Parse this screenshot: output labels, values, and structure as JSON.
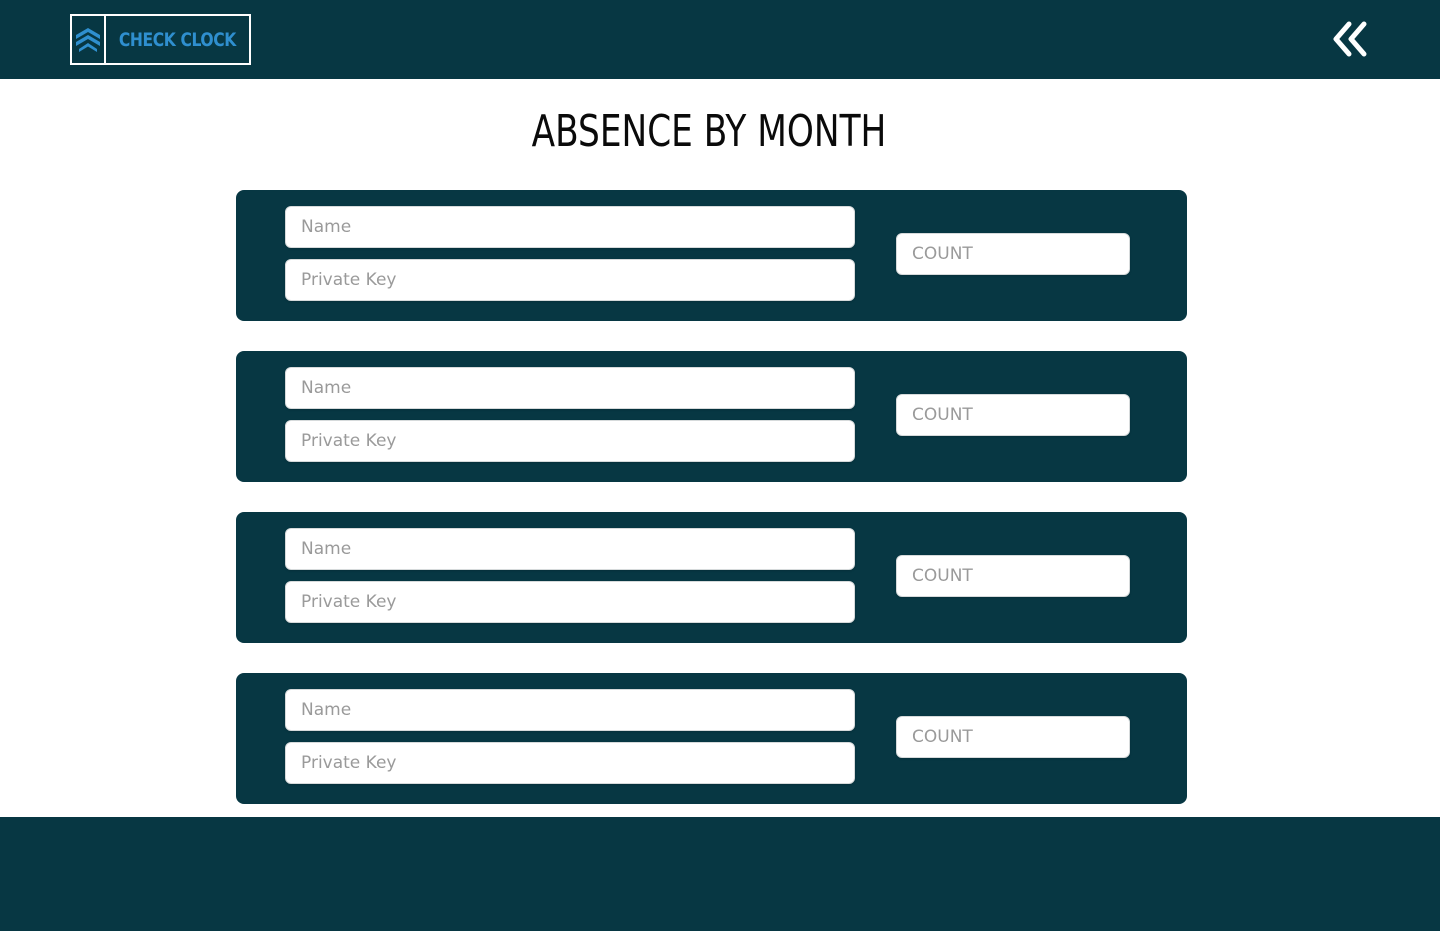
{
  "header": {
    "logo_text": "CHECK CLOCK",
    "logo_color": "#2f8fcf",
    "back_icon": "double-chevron-left-icon",
    "background": "#073743"
  },
  "page": {
    "title": "ABSENCE BY MONTH"
  },
  "cards": [
    {
      "name_placeholder": "Name",
      "key_placeholder": "Private Key",
      "count_placeholder": "COUNT"
    },
    {
      "name_placeholder": "Name",
      "key_placeholder": "Private Key",
      "count_placeholder": "COUNT"
    },
    {
      "name_placeholder": "Name",
      "key_placeholder": "Private Key",
      "count_placeholder": "COUNT"
    },
    {
      "name_placeholder": "Name",
      "key_placeholder": "Private Key",
      "count_placeholder": "COUNT"
    }
  ]
}
